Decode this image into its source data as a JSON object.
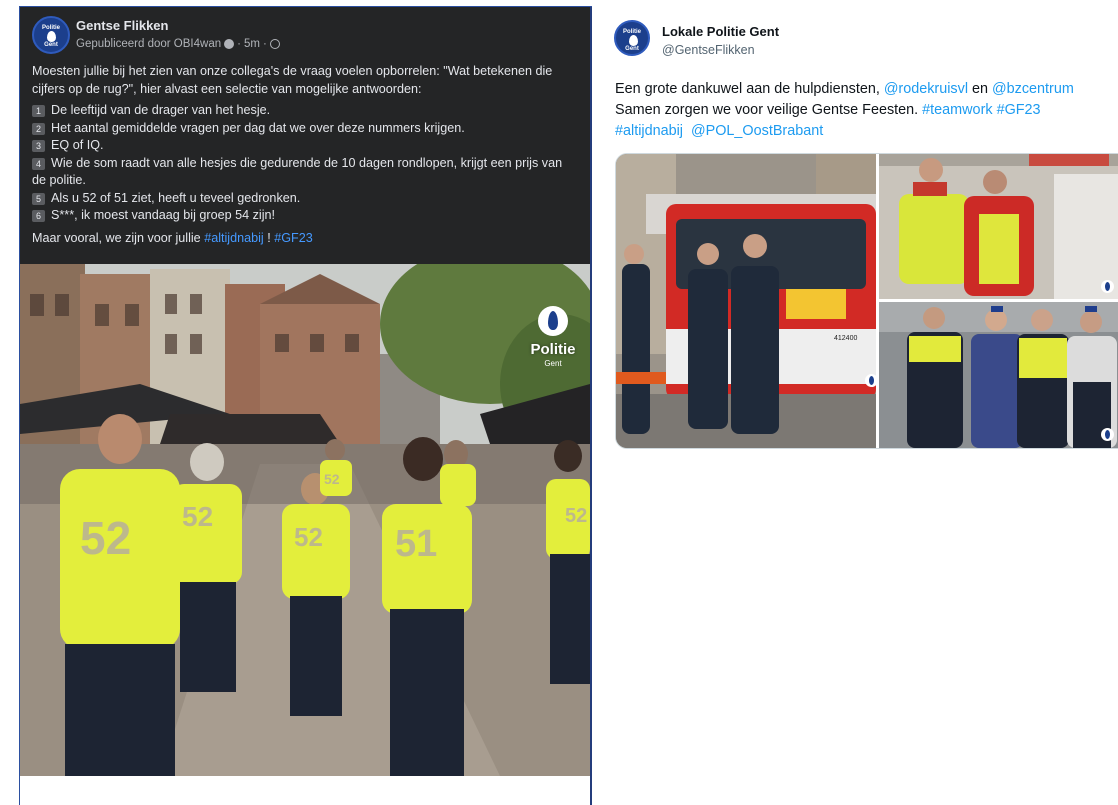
{
  "facebook_post": {
    "avatar_text": [
      "Politie",
      "Gent"
    ],
    "author": "Gentse Flikken",
    "published_by": "Gepubliceerd door OBI4wan",
    "time": "5m",
    "intro_lines": [
      "Moesten jullie bij het zien van onze collega's de vraag voelen opborrelen: \"Wat betekenen die",
      "cijfers op de rug?\", hier alvast een selectie van mogelijke antwoorden:"
    ],
    "list": [
      {
        "num": "1",
        "text": "De leeftijd van de drager van het hesje."
      },
      {
        "num": "2",
        "text": "Het aantal gemiddelde vragen per dag dat we over deze nummers krijgen."
      },
      {
        "num": "3",
        "text": "EQ of IQ."
      },
      {
        "num": "4",
        "text": "Wie de som raadt van alle hesjes die gedurende de 10 dagen rondlopen, krijgt een prijs van",
        "cont": "de politie."
      },
      {
        "num": "5",
        "text": "Als u 52 of 51 ziet, heeft u teveel gedronken."
      },
      {
        "num": "6",
        "text": "S***, ik moest vandaag bij groep 54 zijn!"
      }
    ],
    "outro": "Maar vooral, we zijn voor jullie",
    "hashtag1": "#altijdnabij",
    "bang": " ! ",
    "hashtag2": "#GF23",
    "photo": {
      "logo_word": "Politie",
      "logo_sub": "Gent",
      "vest_numbers": [
        "52",
        "52",
        "52",
        "52",
        "51",
        "52"
      ],
      "vest_color": "#e6f03a"
    }
  },
  "tweet": {
    "avatar_text": [
      "Politie",
      "Gent"
    ],
    "name": "Lokale Politie Gent",
    "handle": "@GentseFlikken",
    "line1_pre": "Een grote dankuwel aan de hulpdiensten, ",
    "mention1": "@rodekruisvl",
    "line1_mid": " en ",
    "mention2": "@bzcentrum",
    "line2_pre": "Samen zorgen we voor veilige Gentse Feesten. ",
    "hashtag1": "#teamwork",
    "line2_mid": " ",
    "hashtag2": "#GF23",
    "hashtag3": "#altijdnabij",
    "line3_gap": "  ",
    "mention3": "@POL_OostBrabant",
    "truck_label": "412400"
  },
  "colors": {
    "fb_card": "#242526",
    "fb_link": "#4599ff",
    "tw_link": "#1d9bf0",
    "police_blue": "#1c3f8c"
  }
}
